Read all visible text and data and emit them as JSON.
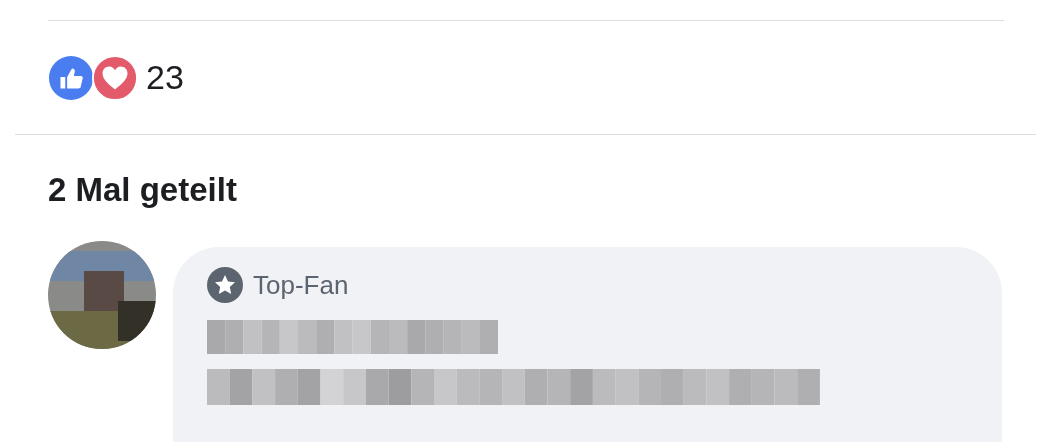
{
  "reactions": {
    "icons": [
      {
        "kind": "like"
      },
      {
        "kind": "love"
      }
    ],
    "count": "23"
  },
  "shares": "2 Mal geteilt",
  "comment": {
    "badge": "Top-Fan"
  }
}
